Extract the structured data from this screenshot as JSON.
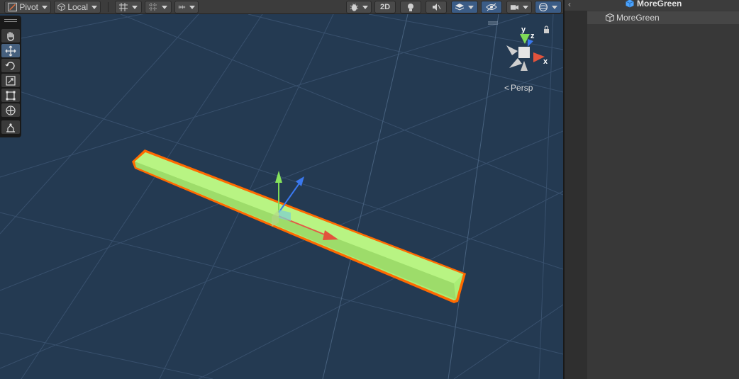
{
  "toolbar": {
    "pivot_label": "Pivot",
    "local_label": "Local",
    "twod_label": "2D"
  },
  "scene": {
    "persp_label": "Persp",
    "gizmo_axes": {
      "y": "y",
      "z": "z",
      "x": "x"
    },
    "object_color": "#a9ee76",
    "outline_color": "#ff6a00",
    "background_color": "#243a52",
    "active_tool": "move"
  },
  "tools": [
    {
      "name": "hand-tool",
      "icon": "hand-icon"
    },
    {
      "name": "move-tool",
      "icon": "move-icon"
    },
    {
      "name": "rotate-tool",
      "icon": "rotate-icon"
    },
    {
      "name": "scale-tool",
      "icon": "scale-icon"
    },
    {
      "name": "rect-tool",
      "icon": "rect-transform-icon"
    },
    {
      "name": "transform-tool",
      "icon": "transform-icon"
    },
    {
      "name": "custom-tool",
      "icon": "custom-tool-icon"
    }
  ],
  "hierarchy": {
    "title": "MoreGreen",
    "items": [
      {
        "label": "MoreGreen"
      }
    ]
  }
}
